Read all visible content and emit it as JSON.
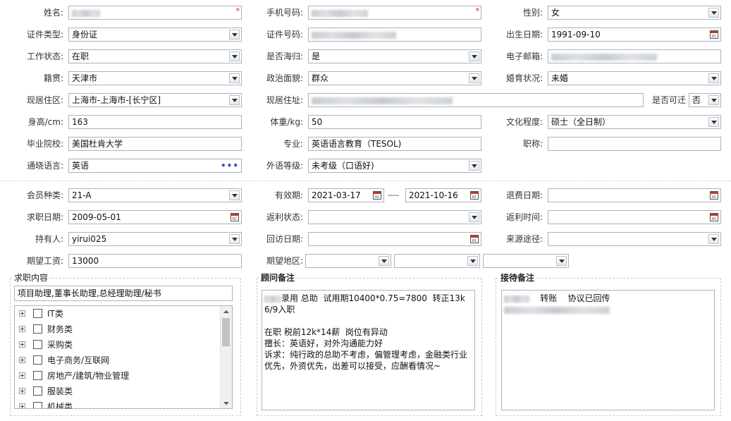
{
  "basic": {
    "name_label": "姓名:",
    "phone_label": "手机号码:",
    "gender_label": "性别:",
    "gender_value": "女",
    "id_type_label": "证件类型:",
    "id_type_value": "身份证",
    "id_number_label": "证件号码:",
    "birth_label": "出生日期:",
    "birth_value": "1991-09-10",
    "work_status_label": "工作状态:",
    "work_status_value": "在职",
    "overseas_label": "是否海归:",
    "overseas_value": "是",
    "email_label": "电子邮箱:",
    "native_label": "籍贯:",
    "native_value": "天津市",
    "political_label": "政治面貌:",
    "political_value": "群众",
    "marital_label": "婚育状况:",
    "marital_value": "未婚",
    "residence_label": "现居住区:",
    "residence_value": "上海市-上海市-[长宁区]",
    "address_label": "现居住址:",
    "relocate_label": "是否可迁",
    "relocate_value": "否",
    "height_label": "身高/cm:",
    "height_value": "163",
    "weight_label": "体重/kg:",
    "weight_value": "50",
    "education_label": "文化程度:",
    "education_value": "硕士（全日制）",
    "school_label": "毕业院校:",
    "school_value": "美国杜肯大学",
    "major_label": "专业:",
    "major_value": "英语语言教育（TESOL)",
    "title_label": "职称:",
    "language_label": "通晓语言:",
    "language_value": "英语",
    "language_more": "•••",
    "foreign_level_label": "外语等级:",
    "foreign_level_value": "未考级（口语好)"
  },
  "member": {
    "type_label": "会员种类:",
    "type_value": "21-A",
    "valid_label": "有效期:",
    "valid_from": "2021-03-17",
    "valid_sep": "----",
    "valid_to": "2021-10-16",
    "refund_date_label": "退费日期:",
    "job_date_label": "求职日期:",
    "job_date_value": "2009-05-01",
    "rebate_status_label": "返利状态:",
    "rebate_time_label": "返利时间:",
    "holder_label": "持有人:",
    "holder_value": "yirui025",
    "visit_date_label": "回访日期:",
    "source_label": "来源途径:",
    "salary_label": "期望工资:",
    "salary_value": "13000",
    "region_label": "期望地区:"
  },
  "panels": {
    "job_title": "求职内容",
    "job_summary": "项目助理,董事长助理,总经理助理/秘书",
    "tree_items": [
      "IT类",
      "财务类",
      "采购类",
      "电子商务/互联网",
      "房地产/建筑/物业管理",
      "服装类",
      "机械类"
    ],
    "consultant_title": "顾问备注",
    "consultant_note_line1_rest": "录用 总助  试用期10400*0.75=7800  转正13k",
    "consultant_note_rest": "6/9入职\n\n在职 税前12k*14薪  岗位有异动\n擅长：英语好，对外沟通能力好\n诉求：纯行政的总助不考虑，偏管理考虑，金融类行业优先，外资优先，出差可以接受，应酬看情况~",
    "reception_title": "接待备注",
    "reception_line1": "转账    协议已回传"
  },
  "colors": {
    "border": "#a9b3bd",
    "required": "#d01818",
    "link_dots": "#2a56c6"
  },
  "icons": [
    "dropdown-arrow-icon",
    "calendar-icon",
    "ellipsis-icon",
    "expand-plus-icon",
    "checkbox-icon"
  ]
}
